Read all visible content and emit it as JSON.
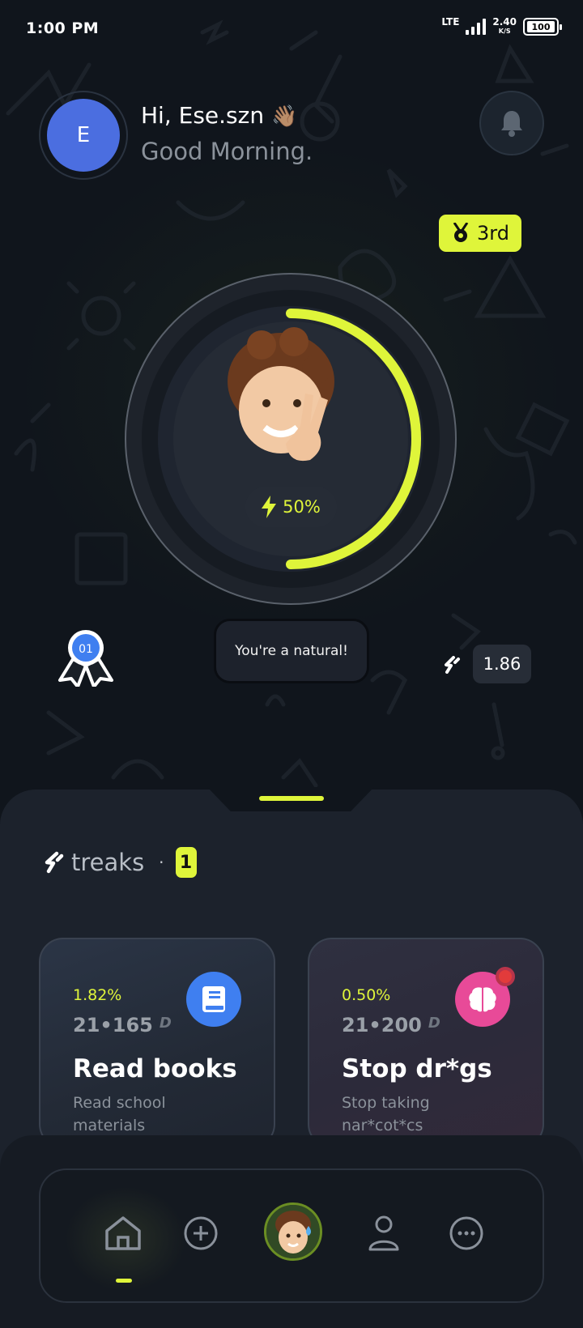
{
  "status_bar": {
    "time": "1:00 PM",
    "network": "LTE",
    "speed_value": "2.40",
    "speed_unit": "K/S",
    "battery": "100"
  },
  "header": {
    "avatar_initial": "E",
    "greeting": "Hi, Ese.szn",
    "greeting_emoji": "👋🏽",
    "subtitle": "Good Morning.",
    "bell_icon": "bell-icon"
  },
  "rank_badge": {
    "label": "3rd",
    "icon": "medal-icon"
  },
  "progress": {
    "fraction": 0.5,
    "energy_label": "50%",
    "accent": "#dff53a"
  },
  "achievements": {
    "badge_number": "01",
    "message": "You're a natural!",
    "streak_value": "1.86"
  },
  "streaks_section": {
    "title": "treaks",
    "separator": "·",
    "count": "1"
  },
  "cards": [
    {
      "percent": "1.82%",
      "range": "21•165",
      "range_unit": "D",
      "title": "Read books",
      "description": "Read school materials",
      "icon": "book-icon",
      "icon_color": "#3f7ff0"
    },
    {
      "percent": "0.50%",
      "range": "21•200",
      "range_unit": "D",
      "title": "Stop dr*gs",
      "description": "Stop taking nar*cot*cs",
      "icon": "brain-icon",
      "icon_color": "#e84a98"
    }
  ],
  "nav": {
    "items": [
      "home-icon",
      "add-icon",
      "avatar",
      "profile-icon",
      "more-icon"
    ],
    "active": "home"
  }
}
